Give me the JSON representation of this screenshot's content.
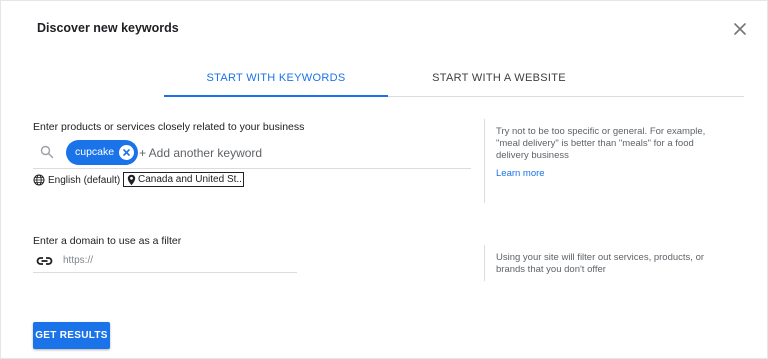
{
  "dialog": {
    "title": "Discover new keywords"
  },
  "tabs": [
    {
      "label": "START WITH KEYWORDS",
      "active": true
    },
    {
      "label": "START WITH A WEBSITE",
      "active": false
    }
  ],
  "keywords_section": {
    "label": "Enter products or services closely related to your business",
    "chips": [
      "cupcake"
    ],
    "input_placeholder": "+ Add another keyword",
    "language": "English (default)",
    "location": "Canada and United St...",
    "help_text": "Try not to be too specific or general. For example, \"meal delivery\" is better than \"meals\" for a food delivery business",
    "learn_more": "Learn more"
  },
  "domain_section": {
    "label": "Enter a domain to use as a filter",
    "input_placeholder": "https://",
    "help_text": "Using your site will filter out services, products, or brands that you don't offer"
  },
  "actions": {
    "submit_label": "GET RESULTS"
  },
  "colors": {
    "accent": "#1a73e8",
    "divider": "#dadce0",
    "muted_text": "#5f6368"
  },
  "icons": {
    "close": "close-icon",
    "search": "search-icon",
    "chip_remove": "close-circle-icon",
    "language": "globe-icon",
    "location": "location-pin-icon",
    "domain": "link-icon"
  }
}
